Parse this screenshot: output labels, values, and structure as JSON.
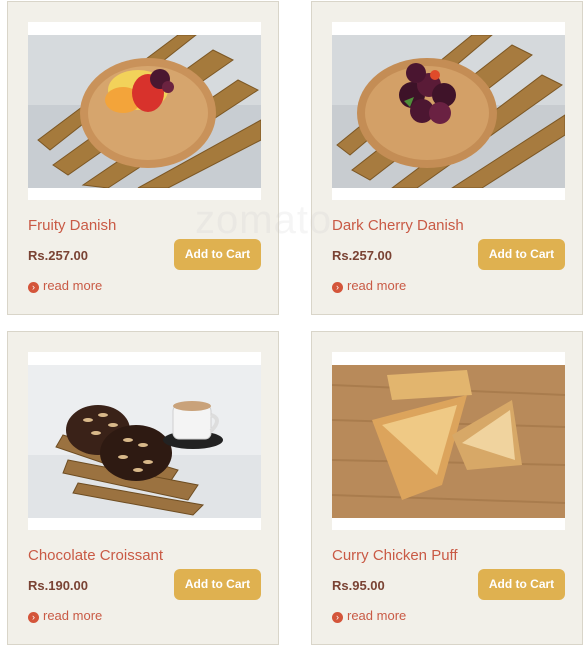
{
  "watermark": "zomato",
  "products": [
    {
      "name": "Fruity Danish",
      "price": "Rs.257.00",
      "add_label": "Add to Cart",
      "read_more": "read more",
      "image": "fruity-danish-photo"
    },
    {
      "name": "Dark Cherry Danish",
      "price": "Rs.257.00",
      "add_label": "Add to Cart",
      "read_more": "read more",
      "image": "dark-cherry-danish-photo"
    },
    {
      "name": "Chocolate Croissant",
      "price": "Rs.190.00",
      "add_label": "Add to Cart",
      "read_more": "read more",
      "image": "chocolate-croissant-photo"
    },
    {
      "name": "Curry Chicken Puff",
      "price": "Rs.95.00",
      "add_label": "Add to Cart",
      "read_more": "read more",
      "image": "curry-chicken-puff-photo"
    }
  ],
  "colors": {
    "card_background": "#f2f0e9",
    "product_name": "#c95a45",
    "price": "#7a4334",
    "button": "#dfb150",
    "arrow_icon": "#d4553a"
  }
}
